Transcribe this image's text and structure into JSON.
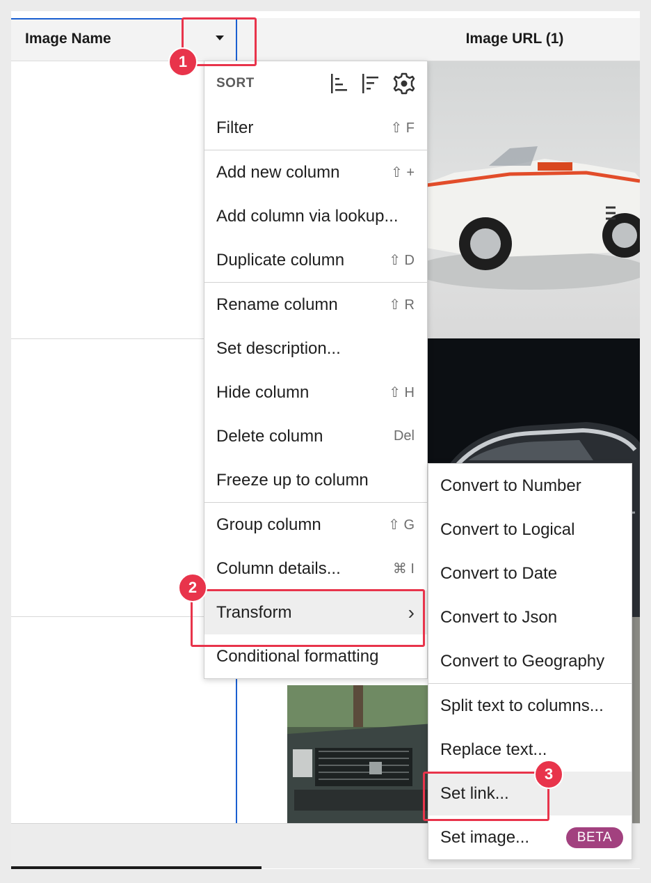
{
  "table": {
    "columns": [
      {
        "label": "Image Name"
      },
      {
        "label": "Image URL (1)"
      }
    ]
  },
  "column_menu": {
    "sort_label": "SORT",
    "sort_icons": [
      "sort-ascending-icon",
      "sort-descending-icon",
      "sort-settings-gear-icon"
    ],
    "groups": [
      [
        {
          "label": "Filter",
          "shortcut": "⇧ F"
        }
      ],
      [
        {
          "label": "Add new column",
          "shortcut": "⇧ +"
        },
        {
          "label": "Add column via lookup...",
          "shortcut": ""
        },
        {
          "label": "Duplicate column",
          "shortcut": "⇧ D"
        }
      ],
      [
        {
          "label": "Rename column",
          "shortcut": "⇧ R"
        },
        {
          "label": "Set description...",
          "shortcut": ""
        },
        {
          "label": "Hide column",
          "shortcut": "⇧ H"
        },
        {
          "label": "Delete column",
          "shortcut": "Del"
        },
        {
          "label": "Freeze up to column",
          "shortcut": ""
        }
      ],
      [
        {
          "label": "Group column",
          "shortcut": "⇧ G"
        },
        {
          "label": "Column details...",
          "shortcut": "⌘ I"
        },
        {
          "label": "Transform",
          "shortcut": "›",
          "highlighted": true
        },
        {
          "label": "Conditional formatting",
          "shortcut": ""
        }
      ]
    ]
  },
  "transform_submenu": {
    "groups": [
      [
        {
          "label": "Convert to Number"
        },
        {
          "label": "Convert to Logical"
        },
        {
          "label": "Convert to Date"
        },
        {
          "label": "Convert to Json"
        },
        {
          "label": "Convert to Geography"
        }
      ],
      [
        {
          "label": "Split text to columns..."
        },
        {
          "label": "Replace text..."
        },
        {
          "label": "Set link...",
          "highlighted": true
        },
        {
          "label": "Set image...",
          "badge": "BETA"
        }
      ]
    ]
  },
  "callouts": [
    "1",
    "2",
    "3"
  ],
  "colors": {
    "callout": "#e8344b",
    "selection": "#1a5fd0",
    "beta_badge": "#a2417f"
  }
}
